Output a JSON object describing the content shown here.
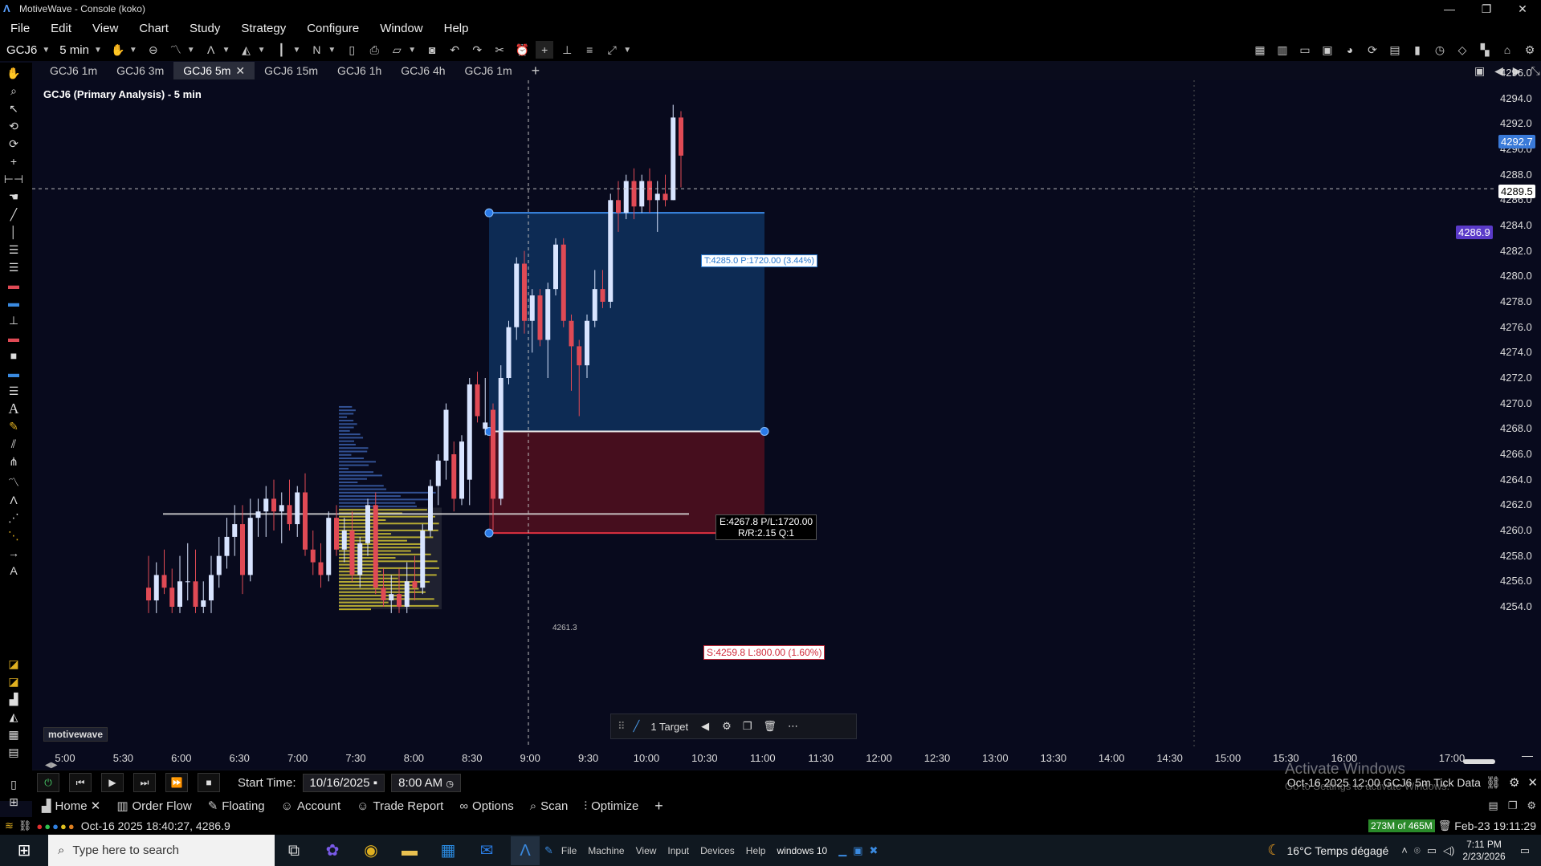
{
  "window": {
    "title": "MotiveWave - Console (koko)",
    "minimize": "—",
    "maximize": "❐",
    "close": "✕"
  },
  "menu": [
    "File",
    "Edit",
    "View",
    "Chart",
    "Study",
    "Strategy",
    "Configure",
    "Window",
    "Help"
  ],
  "toolbar": {
    "symbol": "GCJ6",
    "timeframe": "5 min"
  },
  "chart_tabs": [
    {
      "label": "GCJ6 1m",
      "active": false
    },
    {
      "label": "GCJ6 3m",
      "active": false
    },
    {
      "label": "GCJ6 5m",
      "active": true
    },
    {
      "label": "GCJ6 15m",
      "active": false
    },
    {
      "label": "GCJ6 1h",
      "active": false
    },
    {
      "label": "GCJ6 4h",
      "active": false
    },
    {
      "label": "GCJ6 1m",
      "active": false
    }
  ],
  "chart": {
    "title": "GCJ6 (Primary Analysis) - 5 min",
    "watermark": "motivewave",
    "target_label": "T:4285.0 P:1720.00 (3.44%)",
    "entry_label_line1": "E:4267.8 P/L:1720.00",
    "entry_label_line2": "R/R:2.15 Q:1",
    "stop_label": "S:4259.8 L:800.00 (1.60%)",
    "poc_label": "4261.3",
    "position_toolbar_target": "1 Target",
    "price_badges": {
      "last": "4292.7",
      "current": "4289.5",
      "crosshair": "4286.9"
    },
    "colors": {
      "background": "#080a1d",
      "up_candle": "#d8e4ff",
      "down_candle": "#e04a55",
      "target_zone": "#0e2d57",
      "stop_zone": "#4a0f1f",
      "volume_profile_blue": "#3a5ea8",
      "volume_profile_yellow": "#e0d020"
    }
  },
  "chart_data": {
    "type": "candlestick",
    "title": "GCJ6 (Primary Analysis) - 5 min",
    "y_ticks": [
      "4296.0",
      "4294.0",
      "4292.0",
      "4290.0",
      "4288.0",
      "4286.0",
      "4284.0",
      "4282.0",
      "4280.0",
      "4278.0",
      "4276.0",
      "4274.0",
      "4272.0",
      "4270.0",
      "4268.0",
      "4266.0",
      "4264.0",
      "4262.0",
      "4260.0",
      "4258.0",
      "4256.0",
      "4254.0"
    ],
    "x_ticks": [
      "5:00",
      "5:30",
      "6:00",
      "6:30",
      "7:00",
      "7:30",
      "8:00",
      "8:30",
      "9:00",
      "9:30",
      "10:00",
      "10:30",
      "11:00",
      "11:30",
      "12:00",
      "12:30",
      "13:00",
      "13:30",
      "14:00",
      "14:30",
      "15:00",
      "15:30",
      "16:00",
      "17:00"
    ],
    "ylim": [
      4253.5,
      4296.5
    ],
    "target_price": 4285.0,
    "entry_price": 4267.8,
    "stop_price": 4259.8,
    "poc_price": 4261.3,
    "crosshair_price": 4286.9,
    "candles": [
      {
        "o": 4255.5,
        "h": 4258.0,
        "l": 4253.5,
        "c": 4254.5
      },
      {
        "o": 4254.5,
        "h": 4257.5,
        "l": 4253.5,
        "c": 4256.5
      },
      {
        "o": 4256.5,
        "h": 4258.5,
        "l": 4255.0,
        "c": 4255.5
      },
      {
        "o": 4255.5,
        "h": 4257.0,
        "l": 4253.5,
        "c": 4254.0
      },
      {
        "o": 4254.0,
        "h": 4258.0,
        "l": 4253.5,
        "c": 4256.0
      },
      {
        "o": 4256.0,
        "h": 4259.0,
        "l": 4254.5,
        "c": 4256.0
      },
      {
        "o": 4256.0,
        "h": 4258.5,
        "l": 4253.5,
        "c": 4254.0
      },
      {
        "o": 4254.0,
        "h": 4256.0,
        "l": 4253.5,
        "c": 4254.5
      },
      {
        "o": 4254.5,
        "h": 4258.0,
        "l": 4253.5,
        "c": 4256.5
      },
      {
        "o": 4256.5,
        "h": 4259.5,
        "l": 4255.5,
        "c": 4258.0
      },
      {
        "o": 4258.0,
        "h": 4261.0,
        "l": 4257.0,
        "c": 4259.5
      },
      {
        "o": 4259.5,
        "h": 4262.0,
        "l": 4258.0,
        "c": 4260.5
      },
      {
        "o": 4260.5,
        "h": 4262.0,
        "l": 4255.0,
        "c": 4256.5
      },
      {
        "o": 4256.5,
        "h": 4262.5,
        "l": 4256.0,
        "c": 4261.0
      },
      {
        "o": 4261.0,
        "h": 4262.5,
        "l": 4259.5,
        "c": 4261.5
      },
      {
        "o": 4261.5,
        "h": 4263.5,
        "l": 4259.5,
        "c": 4262.5
      },
      {
        "o": 4262.5,
        "h": 4264.0,
        "l": 4260.0,
        "c": 4261.5
      },
      {
        "o": 4261.5,
        "h": 4263.0,
        "l": 4259.0,
        "c": 4262.0
      },
      {
        "o": 4262.0,
        "h": 4264.0,
        "l": 4260.0,
        "c": 4260.5
      },
      {
        "o": 4260.5,
        "h": 4263.5,
        "l": 4259.5,
        "c": 4263.0
      },
      {
        "o": 4263.0,
        "h": 4264.5,
        "l": 4258.0,
        "c": 4258.5
      },
      {
        "o": 4258.5,
        "h": 4260.0,
        "l": 4256.5,
        "c": 4257.5
      },
      {
        "o": 4257.5,
        "h": 4259.0,
        "l": 4255.5,
        "c": 4256.5
      },
      {
        "o": 4256.5,
        "h": 4261.5,
        "l": 4256.0,
        "c": 4261.0
      },
      {
        "o": 4261.0,
        "h": 4262.0,
        "l": 4258.0,
        "c": 4258.5
      },
      {
        "o": 4258.5,
        "h": 4261.0,
        "l": 4257.5,
        "c": 4260.0
      },
      {
        "o": 4260.0,
        "h": 4261.5,
        "l": 4256.0,
        "c": 4256.5
      },
      {
        "o": 4256.5,
        "h": 4259.5,
        "l": 4255.5,
        "c": 4259.0
      },
      {
        "o": 4259.0,
        "h": 4262.5,
        "l": 4258.0,
        "c": 4262.0
      },
      {
        "o": 4262.0,
        "h": 4263.0,
        "l": 4255.0,
        "c": 4255.5
      },
      {
        "o": 4255.5,
        "h": 4257.0,
        "l": 4254.0,
        "c": 4254.5
      },
      {
        "o": 4254.5,
        "h": 4256.5,
        "l": 4253.5,
        "c": 4255.0
      },
      {
        "o": 4255.0,
        "h": 4257.0,
        "l": 4253.5,
        "c": 4254.0
      },
      {
        "o": 4254.0,
        "h": 4257.5,
        "l": 4253.5,
        "c": 4256.0
      },
      {
        "o": 4256.0,
        "h": 4258.0,
        "l": 4254.5,
        "c": 4255.5
      },
      {
        "o": 4255.5,
        "h": 4260.5,
        "l": 4255.0,
        "c": 4260.0
      },
      {
        "o": 4260.0,
        "h": 4264.0,
        "l": 4259.5,
        "c": 4263.5
      },
      {
        "o": 4263.5,
        "h": 4266.0,
        "l": 4262.0,
        "c": 4265.5
      },
      {
        "o": 4265.5,
        "h": 4270.0,
        "l": 4264.0,
        "c": 4269.5
      },
      {
        "o": 4266.0,
        "h": 4267.0,
        "l": 4261.5,
        "c": 4262.5
      },
      {
        "o": 4262.5,
        "h": 4267.5,
        "l": 4262.0,
        "c": 4267.0
      },
      {
        "o": 4264.0,
        "h": 4272.0,
        "l": 4262.0,
        "c": 4271.5
      },
      {
        "o": 4271.5,
        "h": 4272.5,
        "l": 4268.5,
        "c": 4269.0
      },
      {
        "o": 4268.0,
        "h": 4272.0,
        "l": 4267.5,
        "c": 4268.5
      },
      {
        "o": 4269.5,
        "h": 4270.0,
        "l": 4260.0,
        "c": 4262.5
      },
      {
        "o": 4262.5,
        "h": 4273.0,
        "l": 4262.0,
        "c": 4272.0
      },
      {
        "o": 4272.0,
        "h": 4276.5,
        "l": 4271.5,
        "c": 4276.0
      },
      {
        "o": 4276.0,
        "h": 4281.5,
        "l": 4275.0,
        "c": 4281.0
      },
      {
        "o": 4281.0,
        "h": 4282.0,
        "l": 4275.5,
        "c": 4276.5
      },
      {
        "o": 4276.5,
        "h": 4279.0,
        "l": 4274.0,
        "c": 4278.5
      },
      {
        "o": 4278.5,
        "h": 4279.0,
        "l": 4274.5,
        "c": 4275.0
      },
      {
        "o": 4275.0,
        "h": 4279.5,
        "l": 4272.0,
        "c": 4279.0
      },
      {
        "o": 4279.0,
        "h": 4283.0,
        "l": 4278.5,
        "c": 4282.5
      },
      {
        "o": 4282.5,
        "h": 4283.0,
        "l": 4276.0,
        "c": 4276.5
      },
      {
        "o": 4276.5,
        "h": 4277.0,
        "l": 4271.0,
        "c": 4274.5
      },
      {
        "o": 4274.5,
        "h": 4275.0,
        "l": 4269.0,
        "c": 4273.0
      },
      {
        "o": 4273.0,
        "h": 4277.0,
        "l": 4272.0,
        "c": 4276.5
      },
      {
        "o": 4276.5,
        "h": 4280.5,
        "l": 4276.0,
        "c": 4279.0
      },
      {
        "o": 4279.0,
        "h": 4280.5,
        "l": 4277.5,
        "c": 4278.0
      },
      {
        "o": 4278.0,
        "h": 4286.5,
        "l": 4277.5,
        "c": 4286.0
      },
      {
        "o": 4286.0,
        "h": 4287.5,
        "l": 4283.5,
        "c": 4285.0
      },
      {
        "o": 4285.0,
        "h": 4288.0,
        "l": 4284.5,
        "c": 4287.5
      },
      {
        "o": 4287.5,
        "h": 4288.5,
        "l": 4284.5,
        "c": 4285.5
      },
      {
        "o": 4285.5,
        "h": 4288.0,
        "l": 4285.0,
        "c": 4287.5
      },
      {
        "o": 4287.5,
        "h": 4288.5,
        "l": 4285.0,
        "c": 4286.0
      },
      {
        "o": 4286.0,
        "h": 4287.5,
        "l": 4283.5,
        "c": 4286.5
      },
      {
        "o": 4286.5,
        "h": 4288.0,
        "l": 4285.5,
        "c": 4286.0
      },
      {
        "o": 4286.0,
        "h": 4293.5,
        "l": 4286.0,
        "c": 4292.5
      },
      {
        "o": 4292.5,
        "h": 4293.0,
        "l": 4287.0,
        "c": 4289.5
      }
    ]
  },
  "bottom_controls": {
    "start_time_label": "Start Time:",
    "start_date": "10/16/2025",
    "start_clock": "8:00 AM",
    "right_info": "Oct-16 2025 12:00  GCJ6 5m  Tick Data",
    "activate_title": "Activate Windows",
    "activate_sub": "Go to Settings to activate Windows."
  },
  "bottom_tabs": [
    {
      "label": "Home",
      "icon": "📊"
    },
    {
      "label": "Order Flow",
      "icon": "📈"
    },
    {
      "label": "Floating",
      "icon": "🖌"
    },
    {
      "label": "Account",
      "icon": "👤"
    },
    {
      "label": "Trade Report",
      "icon": "👤"
    },
    {
      "label": "Options",
      "icon": "∞"
    },
    {
      "label": "Scan",
      "icon": "⌕"
    },
    {
      "label": "Optimize",
      "icon": "⫶"
    }
  ],
  "status": {
    "timestamp": "Oct-16 2025 18:40:27, 4286.9",
    "memory": "273M of 465M",
    "clock": "Feb-23 19:11:29"
  },
  "taskbar": {
    "search_placeholder": "Type here to search",
    "weather": "16°C  Temps dégagé",
    "time": "7:11 PM",
    "date": "2/23/2026",
    "vm_menu": [
      "File",
      "Machine",
      "View",
      "Input",
      "Devices",
      "Help"
    ],
    "vm_name": "windows 10"
  }
}
